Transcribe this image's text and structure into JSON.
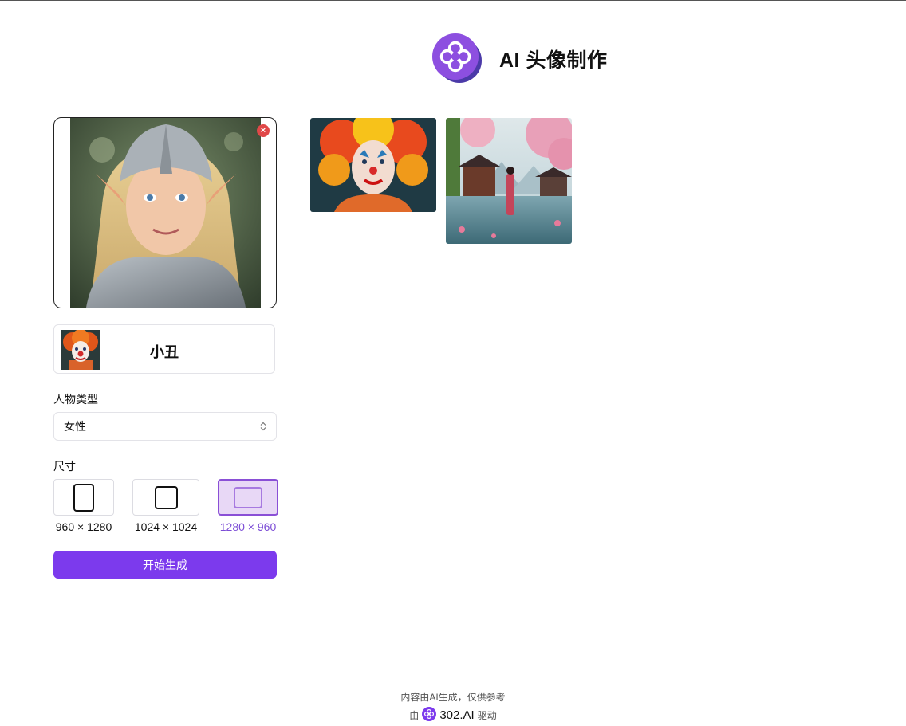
{
  "app": {
    "title": "AI 头像制作",
    "accent_color": "#7c3aed",
    "logo_icon": "clover-logo-icon"
  },
  "upload": {
    "image_alt": "精灵少女头像",
    "remove_icon": "close-icon",
    "remove_glyph": "×"
  },
  "style": {
    "name": "小丑"
  },
  "person_type": {
    "label": "人物类型",
    "value": "女性"
  },
  "size": {
    "label": "尺寸",
    "options": [
      {
        "label": "960 × 1280",
        "selected": false
      },
      {
        "label": "1024 × 1024",
        "selected": false
      },
      {
        "label": "1280 × 960",
        "selected": true
      }
    ]
  },
  "generate_button": {
    "label": "开始生成"
  },
  "gallery": {
    "items": [
      {
        "name": "clown-portrait",
        "alt": "小丑女孩"
      },
      {
        "name": "lakeside-girl",
        "alt": "湖畔少女"
      }
    ]
  },
  "footer": {
    "disclaimer": "内容由AI生成，仅供参考",
    "prefix": "由",
    "brand": "302.AI",
    "suffix": "驱动"
  }
}
